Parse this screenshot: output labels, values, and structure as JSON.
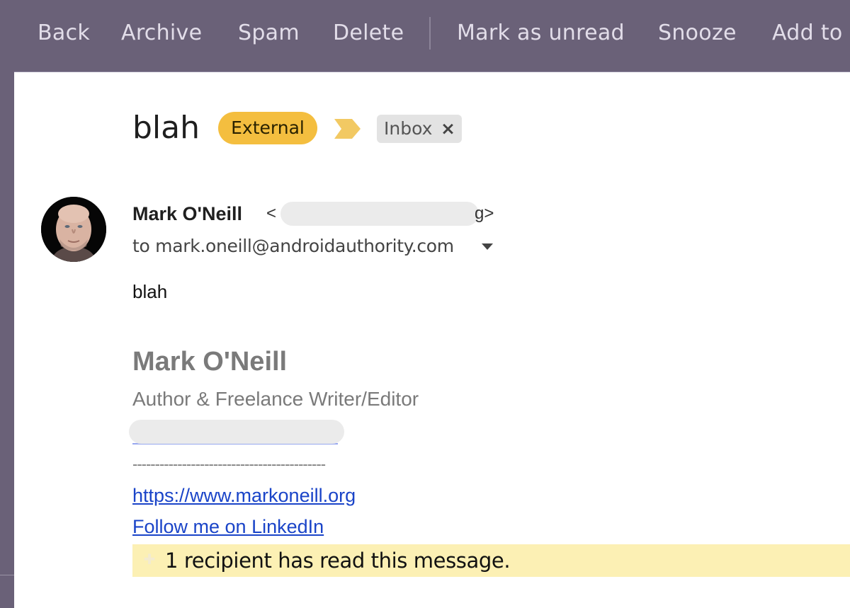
{
  "toolbar": {
    "items": [
      {
        "label": "Back"
      },
      {
        "label": "Archive"
      },
      {
        "label": "Spam"
      },
      {
        "label": "Delete"
      },
      {
        "label": "Mark as unread"
      },
      {
        "label": "Snooze"
      },
      {
        "label": "Add to"
      }
    ]
  },
  "message": {
    "subject": "blah",
    "labels": {
      "external": "External",
      "inbox": "Inbox",
      "inbox_remove": "×"
    },
    "sender": {
      "name": "Mark O'Neill",
      "email_open": "<",
      "email_close": "g>",
      "email_redacted": true
    },
    "recipient_line": "to mark.oneill@androidauthority.com",
    "body": "blah",
    "signature": {
      "name": "Mark O'Neill",
      "title": "Author & Freelance Writer/Editor",
      "separator": "-------------------------------------------",
      "links": [
        {
          "label": "https://www.markoneill.org"
        },
        {
          "label": "Follow me on LinkedIn"
        }
      ]
    },
    "read_receipt": "1 recipient has read this message."
  },
  "colors": {
    "toolbar_bg": "#6a6178",
    "external_label": "#f4be3f",
    "inbox_label": "#e3e3e3",
    "link": "#1a44c8",
    "read_banner": "#fcf0b4"
  }
}
